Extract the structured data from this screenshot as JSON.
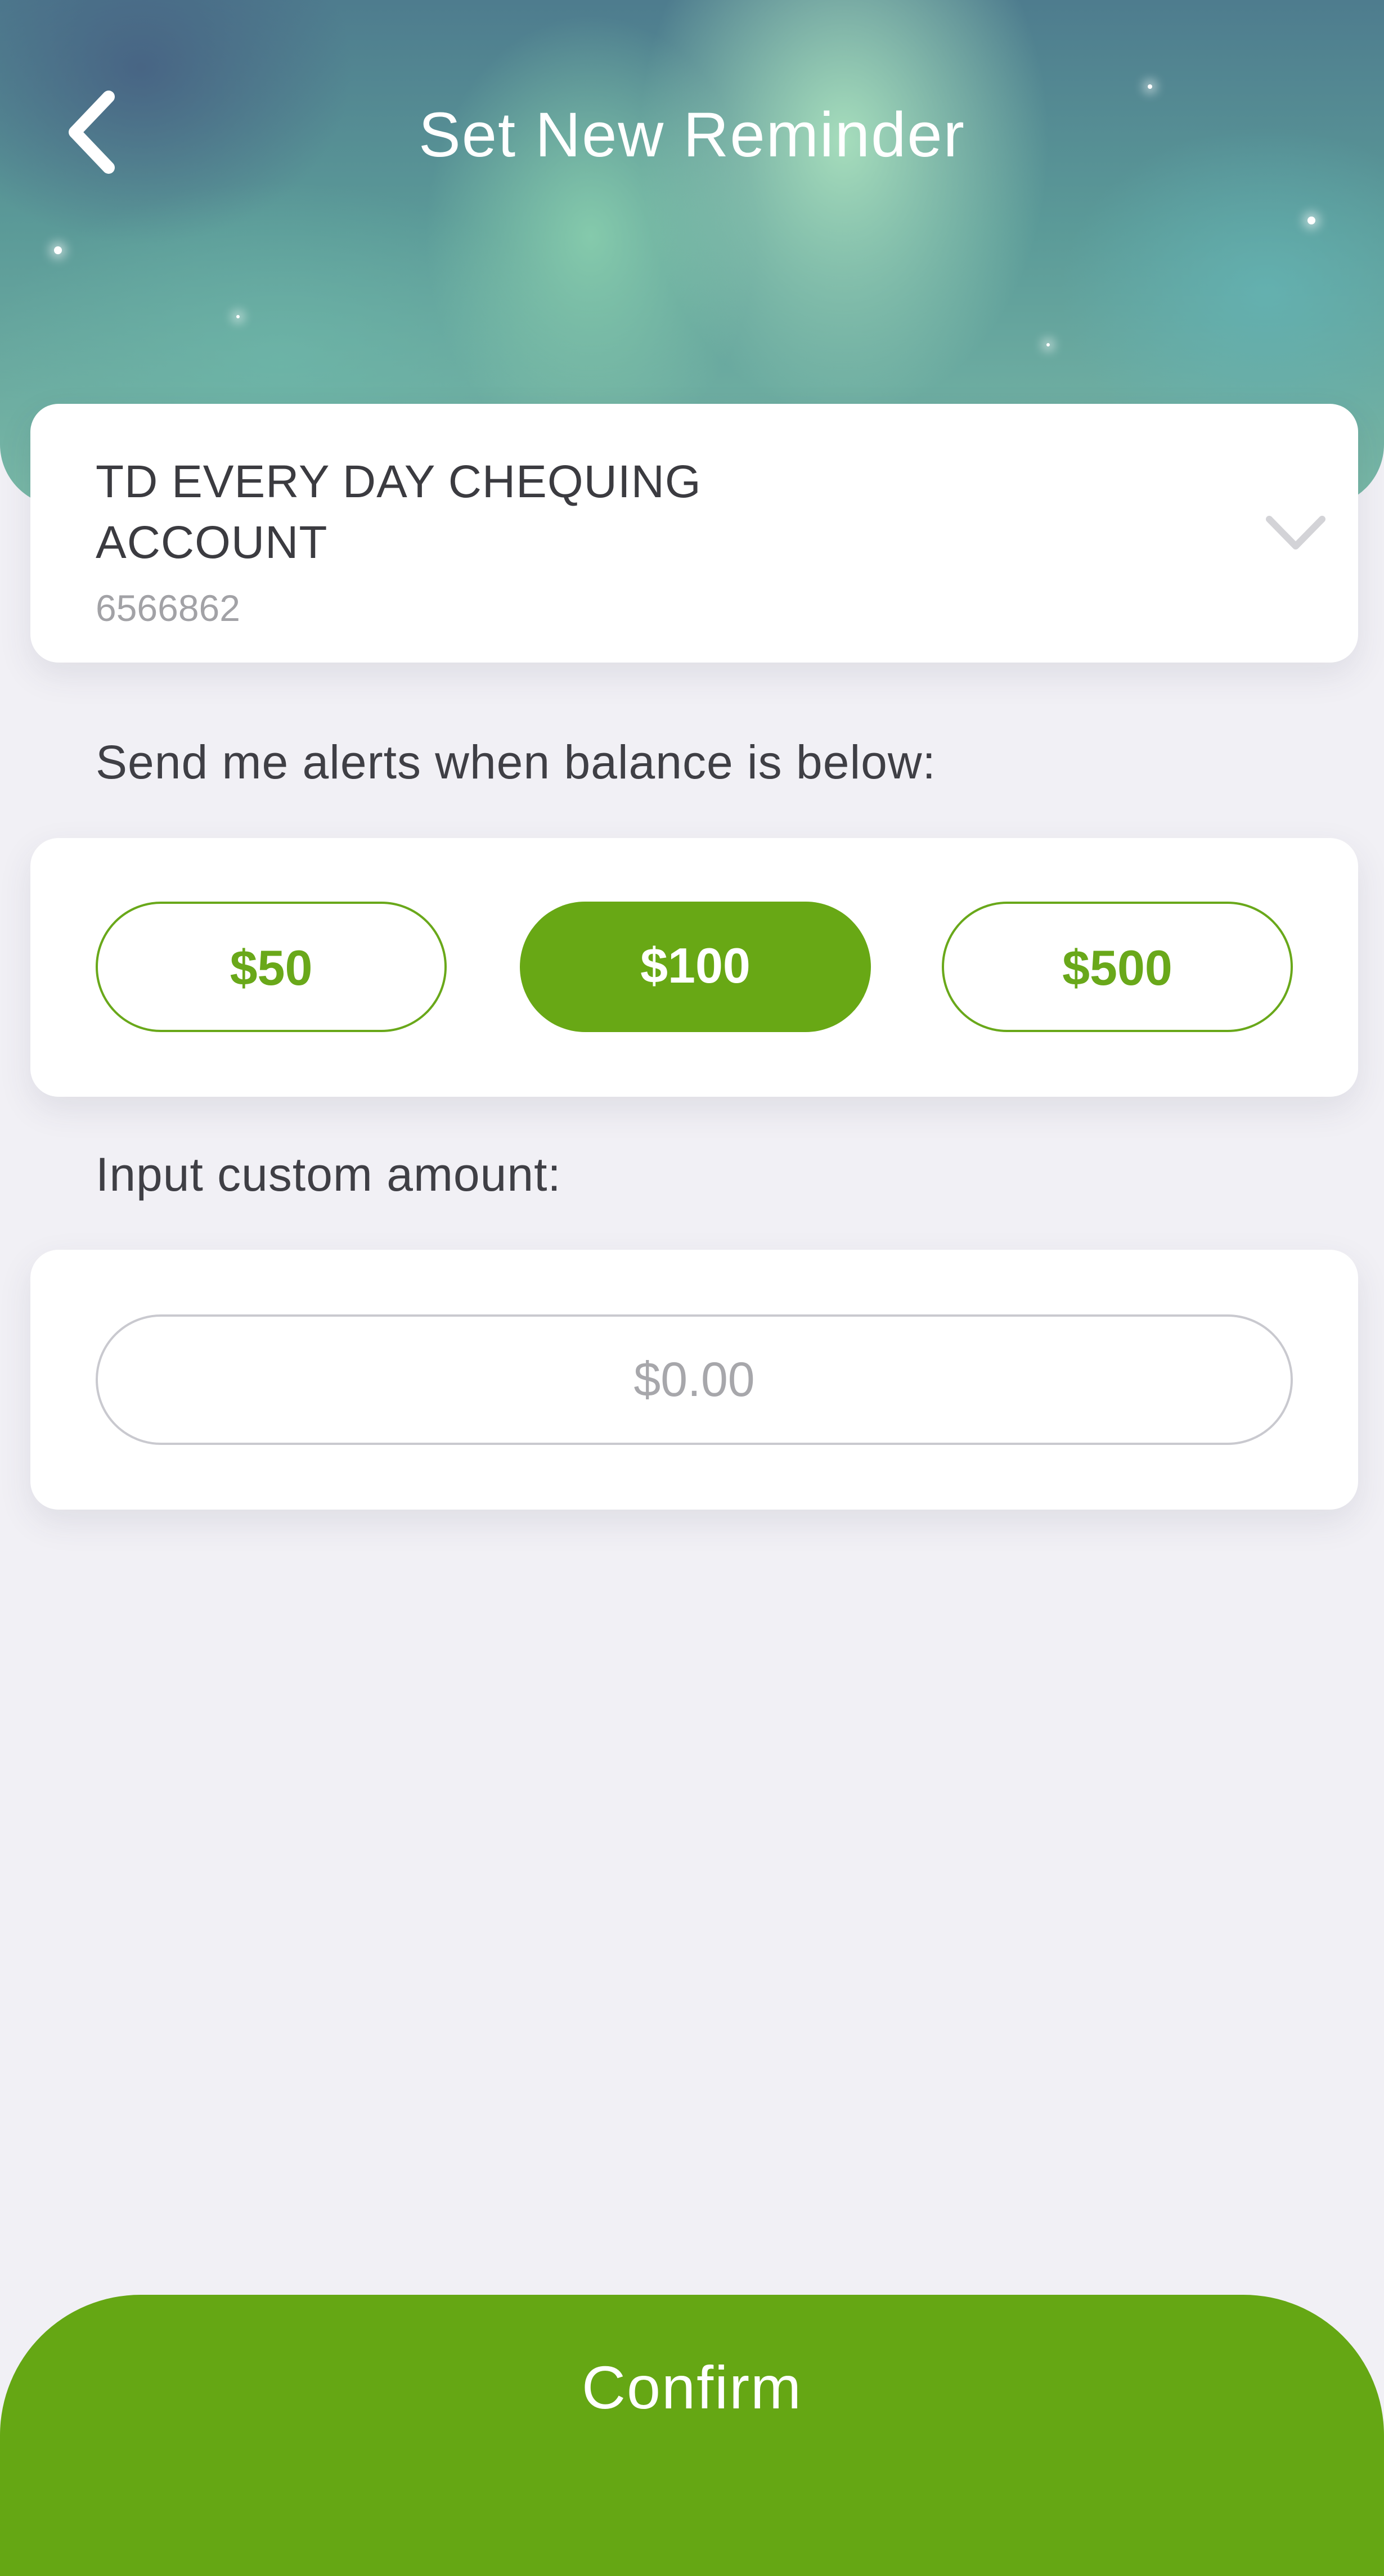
{
  "header": {
    "title": "Set New Reminder",
    "back_icon": "chevron-left-icon"
  },
  "account": {
    "name": "TD EVERY DAY CHEQUING ACCOUNT",
    "number": "6566862",
    "dropdown_icon": "chevron-down-icon"
  },
  "alerts": {
    "label": "Send me alerts when balance is below:",
    "options": [
      {
        "label": "$50",
        "selected": false
      },
      {
        "label": "$100",
        "selected": true
      },
      {
        "label": "$500",
        "selected": false
      }
    ]
  },
  "custom": {
    "label": "Input custom amount:",
    "placeholder": "$0.00",
    "value": ""
  },
  "footer": {
    "confirm_label": "Confirm"
  },
  "colors": {
    "accent_green": "#68a815",
    "page_background": "#f1f0f5",
    "card_background": "#ffffff"
  }
}
